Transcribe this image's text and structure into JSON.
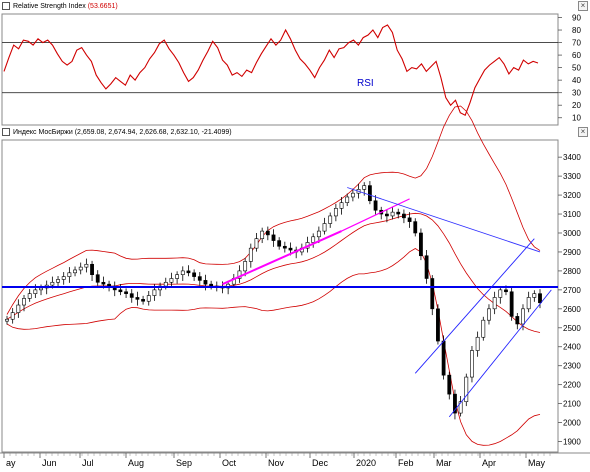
{
  "rsi_panel": {
    "title": "Relative Strength Index",
    "value": "(53.6651)",
    "label": "RSI",
    "close_symbol": "×"
  },
  "price_panel": {
    "title": "Индекс МосБиржи",
    "values": "(2,659.08, 2,674.94, 2,626.68, 2,632.10, -21.4099)",
    "close_symbol": "×"
  },
  "colors": {
    "rsi_line": "#d00000",
    "bollinger": "#d00000",
    "candles": "#000000",
    "resistance_line": "#0000ee",
    "trend_line": "#ff00ff",
    "channel_line": "#2222ff",
    "divergence_line": "#3333ff"
  },
  "chart_data": [
    {
      "type": "line",
      "name": "rsi",
      "ylim": [
        5,
        92
      ],
      "yticks": [
        10,
        20,
        30,
        40,
        50,
        60,
        70,
        80,
        90
      ],
      "levels": [
        30,
        70
      ],
      "values": [
        47,
        58,
        68,
        65,
        72,
        71,
        68,
        73,
        70,
        72,
        68,
        61,
        55,
        52,
        55,
        64,
        66,
        60,
        55,
        44,
        38,
        33,
        37,
        42,
        39,
        36,
        44,
        40,
        46,
        50,
        57,
        62,
        69,
        72,
        65,
        60,
        54,
        46,
        39,
        42,
        48,
        56,
        63,
        71,
        66,
        56,
        52,
        44,
        46,
        43,
        48,
        46,
        54,
        61,
        67,
        73,
        68,
        72,
        80,
        73,
        64,
        57,
        53,
        48,
        42,
        50,
        56,
        64,
        58,
        65,
        66,
        70,
        72,
        68,
        74,
        76,
        80,
        74,
        82,
        84,
        78,
        64,
        57,
        47,
        50,
        49,
        53,
        47,
        51,
        55,
        42,
        26,
        20,
        24,
        14,
        12,
        22,
        34,
        41,
        48,
        52,
        55,
        58,
        53,
        45,
        50,
        48,
        56,
        53,
        55,
        53.7
      ]
    },
    {
      "type": "candlestick",
      "name": "moex",
      "ylim": [
        1850,
        3480
      ],
      "yticks": [
        1900,
        2000,
        2100,
        2200,
        2300,
        2400,
        2500,
        2600,
        2700,
        2800,
        2900,
        3000,
        3100,
        3200,
        3300,
        3400
      ],
      "x_tick_labels": [
        "ay",
        "Jun",
        "Jul",
        "Aug",
        "Sep",
        "Oct",
        "Nov",
        "Dec",
        "2020",
        "Feb",
        "Mar",
        "Apr",
        "May"
      ],
      "close": [
        2545,
        2580,
        2620,
        2655,
        2680,
        2700,
        2710,
        2725,
        2740,
        2755,
        2770,
        2790,
        2805,
        2820,
        2835,
        2780,
        2740,
        2730,
        2720,
        2700,
        2690,
        2680,
        2660,
        2650,
        2640,
        2670,
        2700,
        2720,
        2740,
        2760,
        2780,
        2800,
        2790,
        2770,
        2750,
        2730,
        2720,
        2715,
        2710,
        2730,
        2760,
        2800,
        2850,
        2920,
        2970,
        3010,
        2990,
        2960,
        2930,
        2920,
        2910,
        2900,
        2920,
        2950,
        2980,
        3010,
        3050,
        3090,
        3130,
        3160,
        3190,
        3210,
        3230,
        3250,
        3170,
        3120,
        3100,
        3090,
        3110,
        3100,
        3080,
        3060,
        3000,
        2880,
        2760,
        2600,
        2430,
        2250,
        2150,
        2050,
        2110,
        2240,
        2380,
        2450,
        2540,
        2600,
        2660,
        2700,
        2690,
        2560,
        2520,
        2600,
        2660,
        2680,
        2632
      ],
      "overlays": {
        "bollinger": true,
        "horizontal_level": 2715,
        "uptrend_segment": [
          [
            38,
            2730
          ],
          [
            59,
            3010
          ]
        ],
        "trend_extension": [
          [
            59,
            3010
          ],
          [
            71,
            3180
          ]
        ],
        "falling_line": [
          [
            60,
            3240
          ],
          [
            94,
            2900
          ]
        ],
        "channel_lower": [
          [
            78,
            2030
          ],
          [
            96,
            2700
          ]
        ],
        "channel_upper": [
          [
            72,
            2260
          ],
          [
            93,
            2970
          ]
        ]
      }
    }
  ]
}
